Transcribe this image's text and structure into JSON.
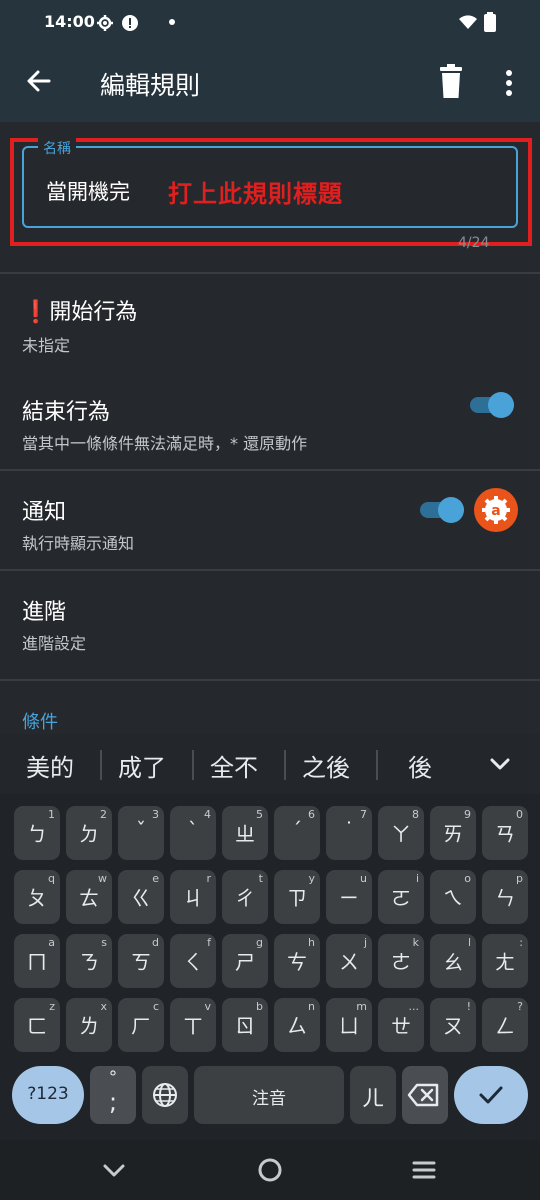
{
  "status_bar": {
    "time": "14:00"
  },
  "app_bar": {
    "title": "編輯規則"
  },
  "name_field": {
    "legend": "名稱",
    "value": "當開機完",
    "hint": "打上此規則標題",
    "counter": "4/24"
  },
  "rows": [
    {
      "title": "❗開始行為",
      "subtitle": "未指定"
    },
    {
      "title": "結束行為",
      "subtitle": "當其中一條條件無法滿足時，* 還原動作",
      "toggle": true
    },
    {
      "title": "通知",
      "subtitle": "執行時顯示通知",
      "toggle": true
    },
    {
      "title": "進階",
      "subtitle": "進階設定"
    }
  ],
  "section": {
    "conditions": "條件"
  },
  "suggestions": [
    "美的",
    "成了",
    "全不",
    "之後",
    "後"
  ],
  "keyboard": {
    "row1": [
      {
        "k": "ㄅ",
        "s": "1"
      },
      {
        "k": "ㄉ",
        "s": "2"
      },
      {
        "k": "ˇ",
        "s": "3"
      },
      {
        "k": "ˋ",
        "s": "4"
      },
      {
        "k": "ㄓ",
        "s": "5"
      },
      {
        "k": "ˊ",
        "s": "6"
      },
      {
        "k": "˙",
        "s": "7"
      },
      {
        "k": "ㄚ",
        "s": "8"
      },
      {
        "k": "ㄞ",
        "s": "9"
      },
      {
        "k": "ㄢ",
        "s": "0"
      }
    ],
    "row2": [
      {
        "k": "ㄆ",
        "s": "q"
      },
      {
        "k": "ㄊ",
        "s": "w"
      },
      {
        "k": "ㄍ",
        "s": "e"
      },
      {
        "k": "ㄐ",
        "s": "r"
      },
      {
        "k": "ㄔ",
        "s": "t"
      },
      {
        "k": "ㄗ",
        "s": "y"
      },
      {
        "k": "ㄧ",
        "s": "u"
      },
      {
        "k": "ㄛ",
        "s": "i"
      },
      {
        "k": "ㄟ",
        "s": "o"
      },
      {
        "k": "ㄣ",
        "s": "p"
      }
    ],
    "row3": [
      {
        "k": "ㄇ",
        "s": "a"
      },
      {
        "k": "ㄋ",
        "s": "s"
      },
      {
        "k": "ㄎ",
        "s": "d"
      },
      {
        "k": "ㄑ",
        "s": "f"
      },
      {
        "k": "ㄕ",
        "s": "g"
      },
      {
        "k": "ㄘ",
        "s": "h"
      },
      {
        "k": "ㄨ",
        "s": "j"
      },
      {
        "k": "ㄜ",
        "s": "k"
      },
      {
        "k": "ㄠ",
        "s": "l"
      },
      {
        "k": "ㄤ",
        "s": ":"
      }
    ],
    "row4": [
      {
        "k": "ㄈ",
        "s": "z"
      },
      {
        "k": "ㄌ",
        "s": "x"
      },
      {
        "k": "ㄏ",
        "s": "c"
      },
      {
        "k": "ㄒ",
        "s": "v"
      },
      {
        "k": "ㄖ",
        "s": "b"
      },
      {
        "k": "ㄙ",
        "s": "n"
      },
      {
        "k": "ㄩ",
        "s": "m"
      },
      {
        "k": "ㄝ",
        "s": "..."
      },
      {
        "k": "ㄡ",
        "s": "!"
      },
      {
        "k": "ㄥ",
        "s": "?"
      }
    ],
    "symbols_label": "?123",
    "punct_top": "°",
    "punct_bottom": ";",
    "space_label": "注音",
    "er_label": "ㄦ"
  },
  "icons": {
    "back": "arrow-left-icon",
    "delete": "trash-icon",
    "more": "more-vert-icon",
    "settings": "gear-icon",
    "alert": "alert-circle-icon",
    "wifi": "wifi-icon",
    "battery": "battery-icon",
    "notification_badge": "automate-icon",
    "globe": "globe-icon",
    "backspace": "backspace-icon",
    "enter": "check-icon",
    "collapse": "chevron-down-icon",
    "nav_back": "nav-back-icon",
    "nav_home": "nav-home-icon",
    "nav_recents": "nav-recents-icon"
  },
  "colors": {
    "accent": "#4aa3d8",
    "annotation_red": "#e01f1f",
    "badge_orange": "#e8541a",
    "toolbar": "#26343d"
  }
}
